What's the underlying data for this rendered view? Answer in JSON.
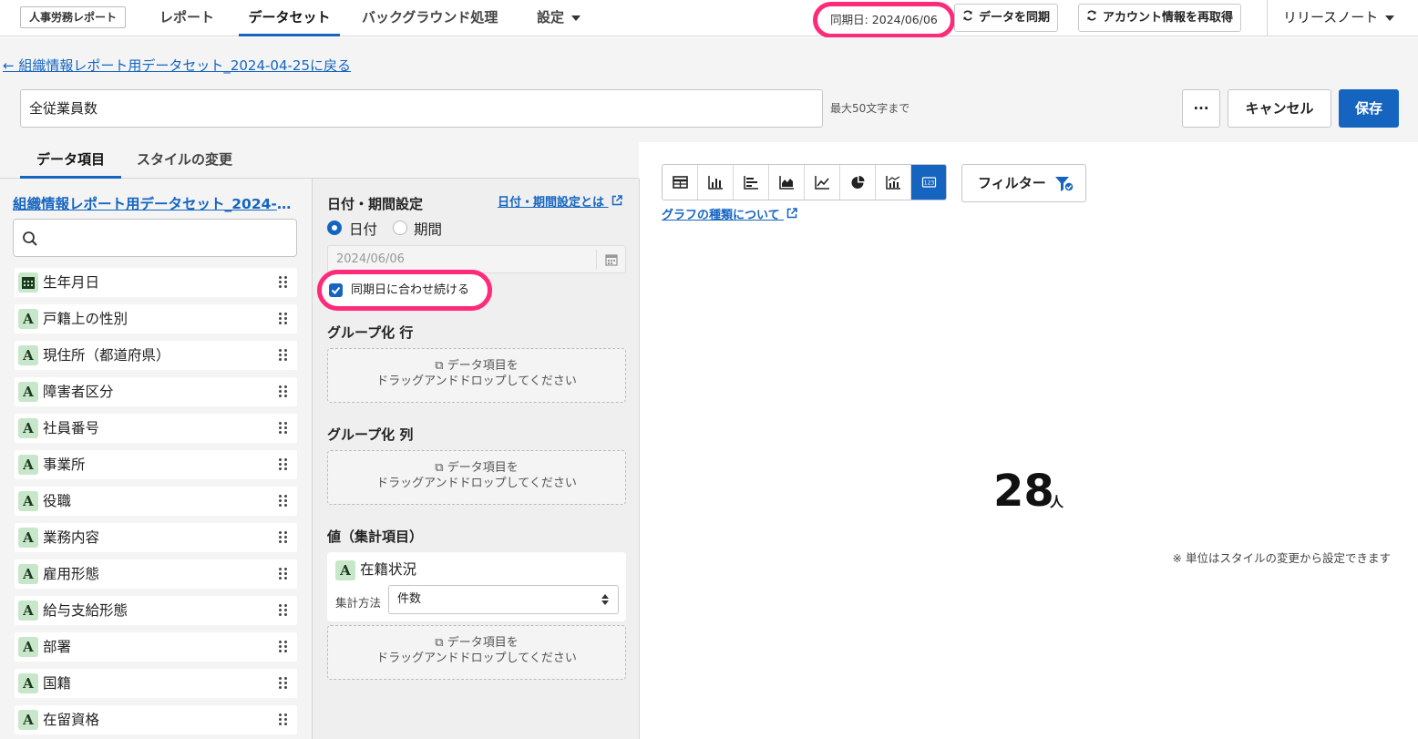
{
  "topnav": {
    "logo": "人事労務レポート",
    "tabs": [
      "レポート",
      "データセット",
      "バックグラウンド処理",
      "設定"
    ],
    "sync_date": "同期日: 2024/06/06",
    "sync_button": "データを同期",
    "refetch_button": "アカウント情報を再取得",
    "release_notes": "リリースノート"
  },
  "header": {
    "back_link": "← 組織情報レポート用データセット_2024-04-25に戻る",
    "name_value": "全従業員数",
    "max_note": "最大50文字まで",
    "more_label": "···",
    "cancel_label": "キャンセル",
    "save_label": "保存"
  },
  "subtabs": [
    "データ項目",
    "スタイルの変更"
  ],
  "dataset": {
    "title": "組織情報レポート用データセット_2024-04-25",
    "search_placeholder": "",
    "fields": [
      {
        "type": "date",
        "label": "生年月日"
      },
      {
        "type": "text",
        "label": "戸籍上の性別"
      },
      {
        "type": "text",
        "label": "現住所（都道府県）"
      },
      {
        "type": "text",
        "label": "障害者区分"
      },
      {
        "type": "text",
        "label": "社員番号"
      },
      {
        "type": "text",
        "label": "事業所"
      },
      {
        "type": "text",
        "label": "役職"
      },
      {
        "type": "text",
        "label": "業務内容"
      },
      {
        "type": "text",
        "label": "雇用形態"
      },
      {
        "type": "text",
        "label": "給与支給形態"
      },
      {
        "type": "text",
        "label": "部署"
      },
      {
        "type": "text",
        "label": "国籍"
      },
      {
        "type": "text",
        "label": "在留資格"
      }
    ],
    "text_type_glyph": "A"
  },
  "settings": {
    "date_title": "日付・期間設定",
    "date_help": "日付・期間設定とは",
    "radio_date": "日付",
    "radio_period": "期間",
    "date_value": "2024/06/06",
    "sync_check_label": "同期日に合わせ続ける",
    "group_row_title": "グループ化 行",
    "group_col_title": "グループ化 列",
    "value_title": "値（集計項目）",
    "drop_line1": "データ項目を",
    "drop_line2": "ドラッグアンドドロップしてください",
    "value_field": "在籍状況",
    "agg_label": "集計方法",
    "agg_value": "件数"
  },
  "chart": {
    "types": [
      "table-icon",
      "bar-chart-icon",
      "horizontal-bar-icon",
      "area-chart-icon",
      "line-chart-icon",
      "pie-chart-icon",
      "combo-chart-icon",
      "number-card-icon"
    ],
    "active_type": "number-card-icon",
    "filter_label": "フィルター",
    "help_link": "グラフの種類について",
    "value": "28",
    "unit": "人",
    "unit_note": "※ 単位はスタイルの変更から設定できます"
  },
  "colors": {
    "accent": "#1565c0",
    "highlight": "#ff2a7a",
    "text_field_badge": "#c8e6c9"
  }
}
